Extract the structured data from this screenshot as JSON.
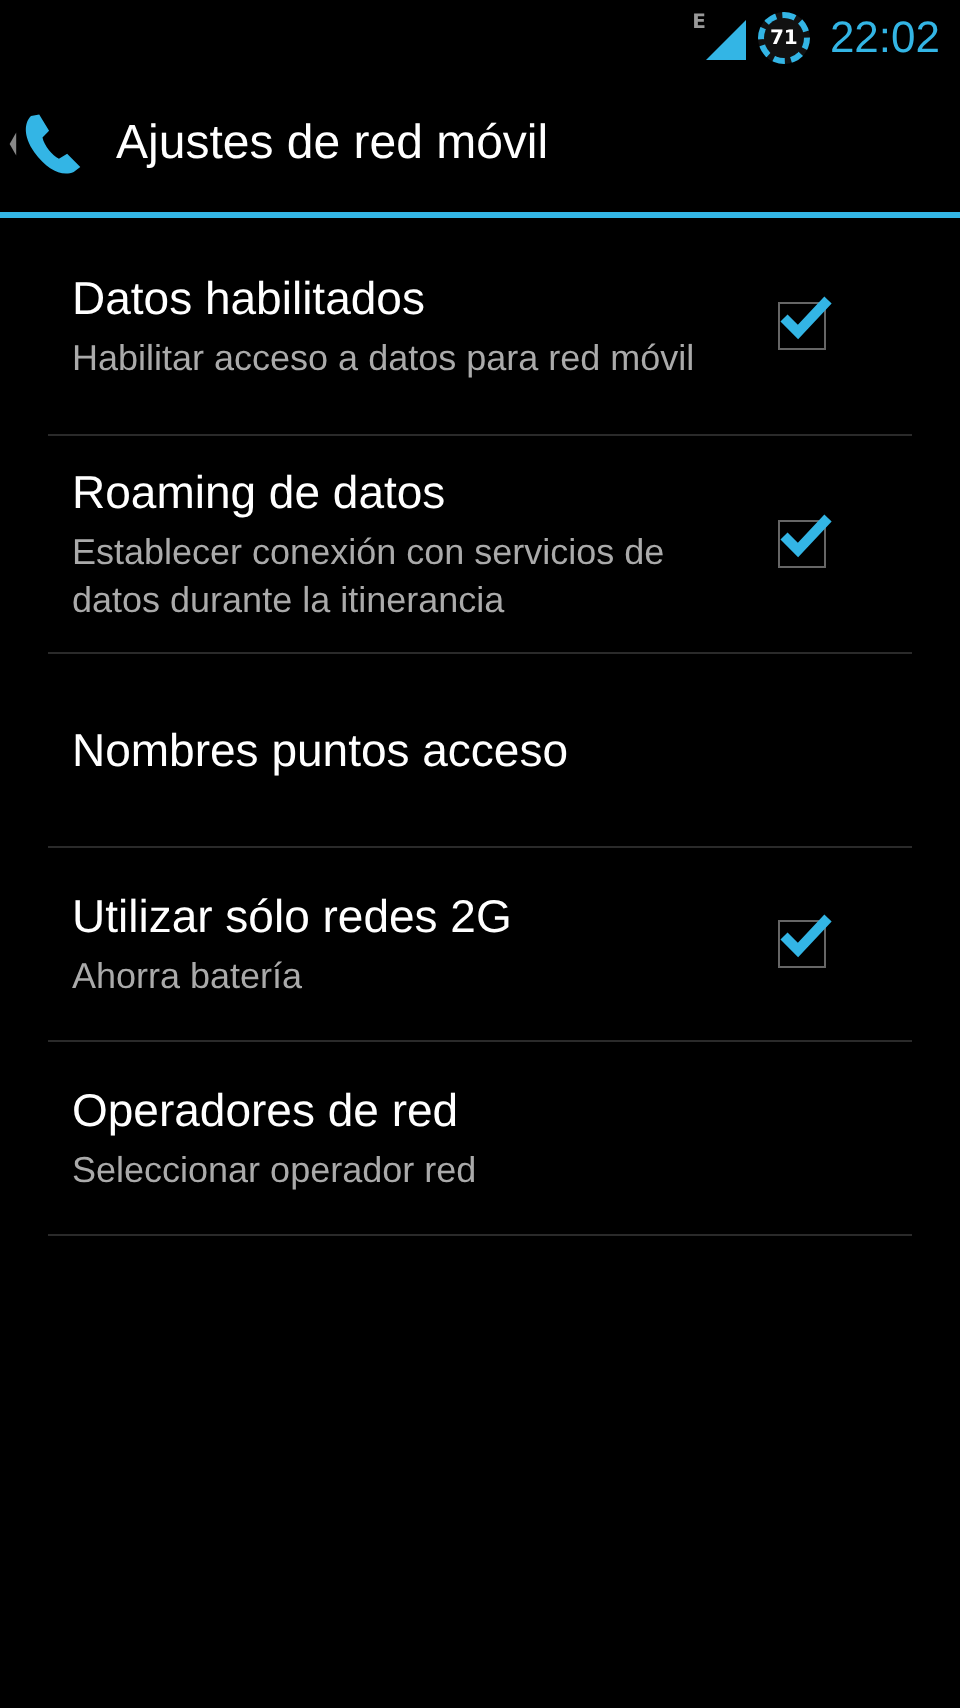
{
  "status_bar": {
    "network_type": "E",
    "battery": "71",
    "time": "22:02"
  },
  "action_bar": {
    "title": "Ajustes de red móvil"
  },
  "settings": [
    {
      "kind": "checkbox",
      "title": "Datos habilitados",
      "summary": "Habilitar acceso a datos para red móvil",
      "checked": true
    },
    {
      "kind": "checkbox",
      "title": "Roaming de datos",
      "summary": "Establecer conexión con servicios de datos durante la itinerancia",
      "checked": true
    },
    {
      "kind": "plain",
      "title": "Nombres puntos acceso"
    },
    {
      "kind": "checkbox",
      "title": "Utilizar sólo redes 2G",
      "summary": "Ahorra batería",
      "checked": true
    },
    {
      "kind": "plain",
      "title": "Operadores de red",
      "summary": "Seleccionar operador red"
    }
  ]
}
